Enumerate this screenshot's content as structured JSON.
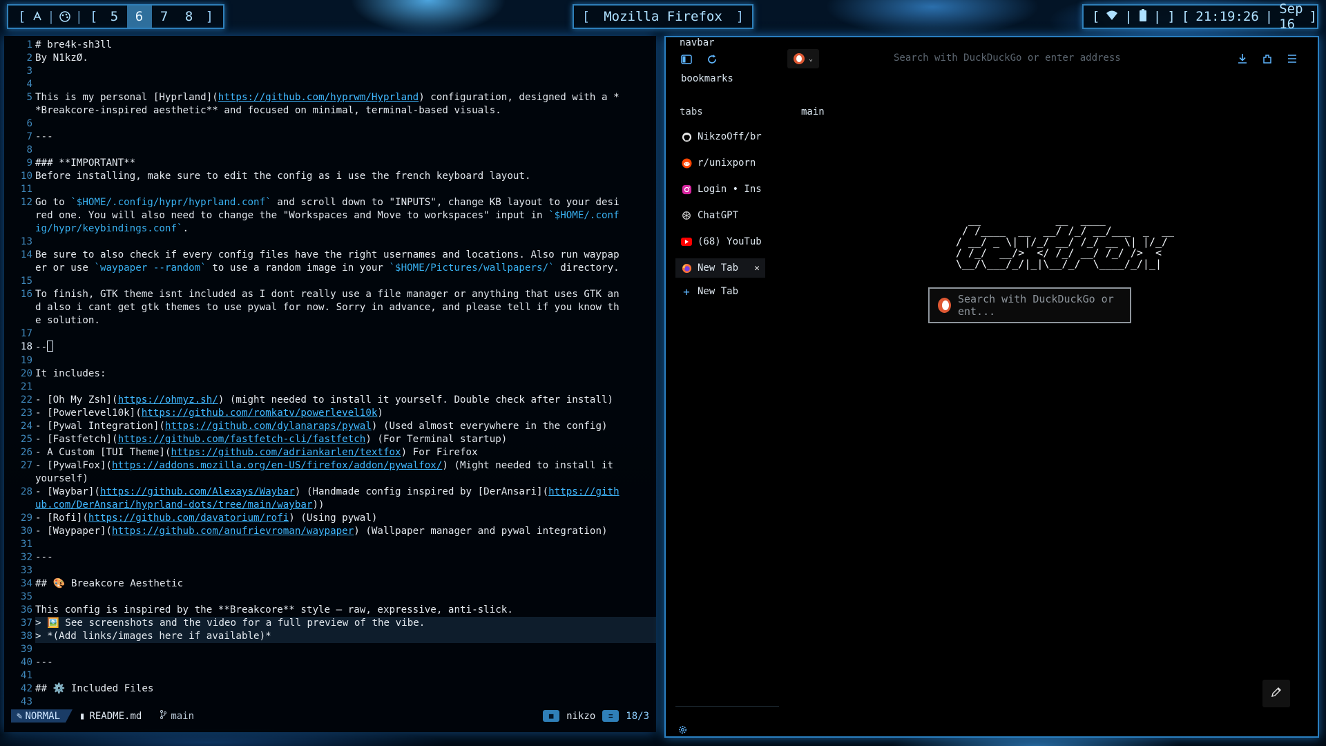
{
  "topbar": {
    "workspaces": [
      "5",
      "6",
      "7",
      "8"
    ],
    "active_workspace": "6",
    "window_title": "Mozilla Firefox",
    "status": {
      "time": "21:19:26",
      "date": "Sep 16"
    },
    "icons": [
      "hyprland-icon",
      "palette-icon",
      "wifi-icon",
      "battery-icon"
    ]
  },
  "editor": {
    "lines": [
      {
        "n": "1",
        "t": "# bre4k-sh3ll"
      },
      {
        "n": "2",
        "t": "By N1kzØ."
      },
      {
        "n": "3",
        "t": ""
      },
      {
        "n": "4",
        "t": ""
      },
      {
        "n": "5",
        "t": "This is my personal [Hyprland](https://github.com/hyprwm/Hyprland) configuration, designed with a *"
      },
      {
        "n": "",
        "t": "*Breakcore-inspired aesthetic** and focused on minimal, terminal-based visuals."
      },
      {
        "n": "6",
        "t": ""
      },
      {
        "n": "7",
        "t": "---"
      },
      {
        "n": "8",
        "t": ""
      },
      {
        "n": "9",
        "t": "### **IMPORTANT**"
      },
      {
        "n": "10",
        "t": "Before installing, make sure to edit the config as i use the french keyboard layout."
      },
      {
        "n": "11",
        "t": ""
      },
      {
        "n": "12",
        "t": "Go to `$HOME/.config/hypr/hyprland.conf` and scroll down to \"INPUTS\", change KB layout to your desi"
      },
      {
        "n": "",
        "t": "red one. You will also need to change the \"Workspaces and Move to workspaces\" input in `$HOME/.conf"
      },
      {
        "n": "",
        "t": "ig/hypr/keybindings.conf`."
      },
      {
        "n": "13",
        "t": ""
      },
      {
        "n": "14",
        "t": "Be sure to also check if every config files have the right usernames and locations. Also run waypap"
      },
      {
        "n": "",
        "t": "er or use `waypaper --random` to use a random image in your `$HOME/Pictures/wallpapers/` directory."
      },
      {
        "n": "15",
        "t": ""
      },
      {
        "n": "16",
        "t": "To finish, GTK theme isnt included as I dont really use a file manager or anything that uses GTK an"
      },
      {
        "n": "",
        "t": "d also i cant get gtk themes to use pywal for now. Sorry in advance, and please tell if you know th"
      },
      {
        "n": "",
        "t": "e solution."
      },
      {
        "n": "17",
        "t": ""
      },
      {
        "n": "18",
        "t": "--"
      },
      {
        "n": "19",
        "t": ""
      },
      {
        "n": "20",
        "t": "It includes:"
      },
      {
        "n": "21",
        "t": ""
      },
      {
        "n": "22",
        "t": "- [Oh My Zsh](https://ohmyz.sh/) (might needed to install it yourself. Double check after install)"
      },
      {
        "n": "23",
        "t": "- [Powerlevel10k](https://github.com/romkatv/powerlevel10k)"
      },
      {
        "n": "24",
        "t": "- [Pywal Integration](https://github.com/dylanaraps/pywal) (Used almost everywhere in the config)"
      },
      {
        "n": "25",
        "t": "- [Fastfetch](https://github.com/fastfetch-cli/fastfetch) (For Terminal startup)"
      },
      {
        "n": "26",
        "t": "- A Custom [TUI Theme](https://github.com/adriankarlen/textfox) For Firefox"
      },
      {
        "n": "27",
        "t": "- [PywalFox](https://addons.mozilla.org/en-US/firefox/addon/pywalfox/) (Might needed to install it"
      },
      {
        "n": "",
        "t": "yourself)"
      },
      {
        "n": "28",
        "t": "- [Waybar](https://github.com/Alexays/Waybar) (Handmade config inspired by [DerAnsari](https://gith"
      },
      {
        "n": "",
        "t": "ub.com/DerAnsari/hyprland-dots/tree/main/waybar))"
      },
      {
        "n": "29",
        "t": "- [Rofi](https://github.com/davatorium/rofi) (Using pywal)"
      },
      {
        "n": "30",
        "t": "- [Waypaper](https://github.com/anufrievroman/waypaper) (Wallpaper manager and pywal integration)"
      },
      {
        "n": "31",
        "t": ""
      },
      {
        "n": "32",
        "t": "---"
      },
      {
        "n": "33",
        "t": ""
      },
      {
        "n": "34",
        "t": "## 🎨 Breakcore Aesthetic"
      },
      {
        "n": "35",
        "t": ""
      },
      {
        "n": "36",
        "t": "This config is inspired by the **Breakcore** style — raw, expressive, anti-slick."
      },
      {
        "n": "37",
        "t": "> 🖼️ See screenshots and the video for a full preview of the vibe."
      },
      {
        "n": "38",
        "t": "> *(Add links/images here if available)*"
      },
      {
        "n": "39",
        "t": ""
      },
      {
        "n": "40",
        "t": "---"
      },
      {
        "n": "41",
        "t": ""
      },
      {
        "n": "42",
        "t": "## ⚙️ Included Files"
      },
      {
        "n": "43",
        "t": ""
      }
    ],
    "statusline": {
      "mode": "NORMAL",
      "file": "README.md",
      "branch": "main",
      "user": "nikzo",
      "position": "18/3"
    }
  },
  "firefox": {
    "navbar_label": "navbar",
    "bookmarks_label": "bookmarks",
    "tabs_label": "tabs",
    "main_label": "main",
    "address_placeholder": "Search with DuckDuckGo or enter address",
    "tabs": [
      {
        "title": "NikzoOff/br",
        "icon": "github-icon"
      },
      {
        "title": "r/unixporn",
        "icon": "reddit-icon"
      },
      {
        "title": "Login • Ins",
        "icon": "instagram-icon"
      },
      {
        "title": "ChatGPT",
        "icon": "chatgpt-icon"
      },
      {
        "title": "(68) YouTub",
        "icon": "youtube-icon"
      },
      {
        "title": "New Tab",
        "icon": "firefox-icon",
        "active": true
      }
    ],
    "new_tab_label": "New Tab",
    "newtab_search_placeholder": "Search with DuckDuckGo or ent...",
    "ascii_art": "  __            __  ____\n / /____  __  __/ /_/ __/___  _  __\n/ __/ _ \\| |/_/ __/ /_/ __ \\| |/_/\n/ /_/  __/>  </ /_/ __/ /_/ />  <\n\\__/\\___/_/|_|\\__/_/  \\____/_/|_|",
    "colors": {
      "accent": "#2a7fc0",
      "bg": "#000000"
    }
  }
}
